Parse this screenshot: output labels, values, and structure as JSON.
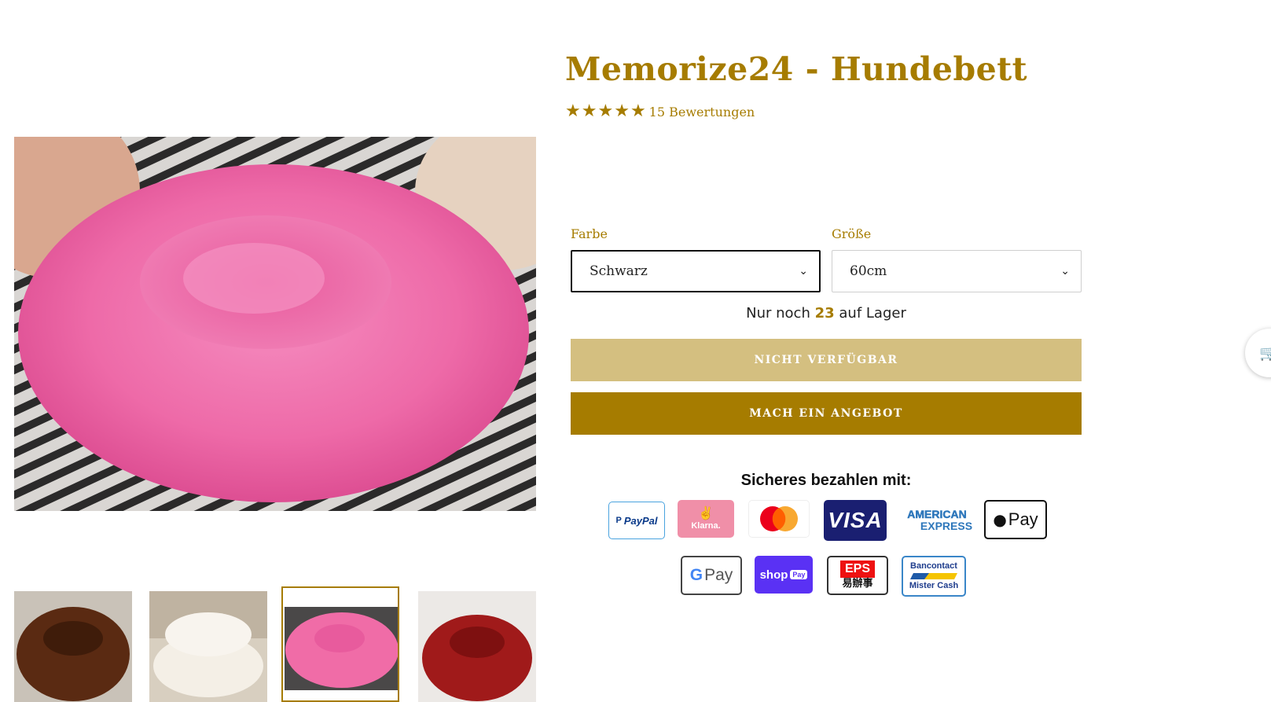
{
  "product": {
    "title": "Memorize24 - Hundebett",
    "rating_stars": 5,
    "rating_glyph": "★",
    "reviews": "15 Bewertungen"
  },
  "options": {
    "color_label": "Farbe",
    "color_value": "Schwarz",
    "size_label": "Größe",
    "size_value": "60cm",
    "chevron": "⌄"
  },
  "stock": {
    "prefix": "Nur noch",
    "count": "23",
    "suffix": "auf Lager"
  },
  "buttons": {
    "unavailable": "NICHT VERFÜGBAR",
    "offer": "MACH EIN ANGEBOT"
  },
  "payments": {
    "title": "Sicheres bezahlen mit:",
    "paypal": "PayPal",
    "klarna": "Klarna.",
    "visa": "VISA",
    "amex_line1": "AMERICAN",
    "amex_line2": "EXPRESS",
    "applepay": "Pay",
    "googlepay_g": "G",
    "googlepay": "Pay",
    "shoppay": "shop",
    "shoppay_badge": "Pay",
    "eps": "EPS",
    "eps_sub": "易辦事",
    "bancontact_line1": "Bancontact",
    "bancontact_line2": "Mister Cash"
  },
  "cart_icon": "🛒",
  "colors": {
    "accent": "#a67c00",
    "accent_light": "#d4bf80",
    "pink": "#f06ca7",
    "brown": "#5a2a12",
    "cream": "#f4efe6",
    "red": "#a01a1a"
  }
}
